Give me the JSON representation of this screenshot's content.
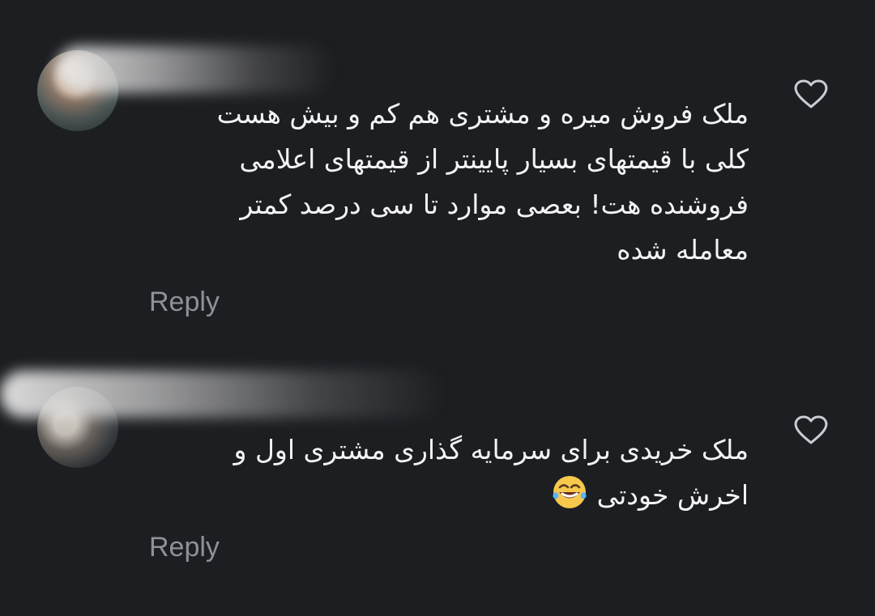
{
  "comments": [
    {
      "lines": [
        "ملک فروش میره و مشتری هم کم و بیش هست",
        "کلی با قیمتهای بسیار پایینتر از قیمتهای اعلامی",
        "فروشنده هت! بعصی موارد تا سی درصد کمتر",
        "معامله شده"
      ],
      "reply_label": "Reply",
      "like_icon": "heart-icon",
      "avatar_icon": "avatar"
    },
    {
      "lines": [
        "ملک خریدی برای سرمایه گذاری مشتری اول و",
        "اخرش خودتی"
      ],
      "reply_label": "Reply",
      "like_icon": "heart-icon",
      "avatar_icon": "avatar",
      "emoji_icon": "face-with-tears-of-joy-icon"
    }
  ],
  "colors": {
    "background": "#1c1e22",
    "text": "#f3f3f3",
    "secondary_text": "#8d9298",
    "icon": "#c9ccd0"
  }
}
